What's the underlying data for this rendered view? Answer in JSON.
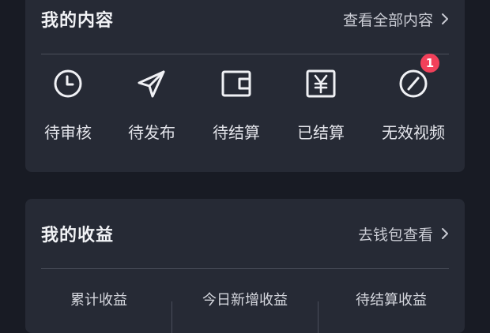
{
  "content_card": {
    "title": "我的内容",
    "view_all_label": "查看全部内容",
    "items": [
      {
        "label": "待审核",
        "icon": "clock-icon"
      },
      {
        "label": "待发布",
        "icon": "send-icon"
      },
      {
        "label": "待结算",
        "icon": "wallet-icon"
      },
      {
        "label": "已结算",
        "icon": "yen-icon"
      },
      {
        "label": "无效视频",
        "icon": "invalid-icon",
        "badge": "1"
      }
    ]
  },
  "earnings_card": {
    "title": "我的收益",
    "wallet_link_label": "去钱包查看",
    "stats": [
      {
        "label": "累计收益"
      },
      {
        "label": "今日新增收益"
      },
      {
        "label": "待结算收益"
      }
    ]
  },
  "colors": {
    "background": "#181b24",
    "card": "#262a35",
    "badge": "#f2405a",
    "text": "#e8e9ee"
  }
}
